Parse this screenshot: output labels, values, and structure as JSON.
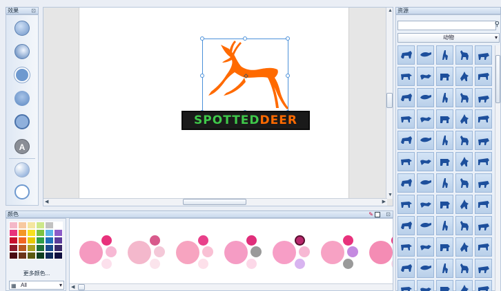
{
  "panels": {
    "effects": "效果",
    "colors": "颜色",
    "resources": "资源"
  },
  "resources": {
    "search_placeholder": "",
    "category": "动物"
  },
  "colors": {
    "more_label": "更多颜色...",
    "filter": "All",
    "swatches": [
      "#f4b8c8",
      "#f7c9a0",
      "#f4e6a0",
      "#cde88a",
      "#c2c2c2",
      "#ffffff",
      "#e8327c",
      "#f39826",
      "#f7e020",
      "#7cc242",
      "#5ab4e8",
      "#8c5cc8",
      "#c8102e",
      "#f26722",
      "#e8c800",
      "#2e9e48",
      "#1e6fb8",
      "#5a3c9a",
      "#8c1a2a",
      "#b85a20",
      "#a8a020",
      "#1e6e3a",
      "#1a4a8c",
      "#3a2a6a",
      "#4a0a10",
      "#6a3418",
      "#5a5a10",
      "#0e3e20",
      "#0e2a5a",
      "#101040"
    ]
  },
  "logo": {
    "word1": "SPOTTED",
    "word2": "DEER"
  },
  "accent": "#4a90d9",
  "palettes": [
    {
      "main": "#f59ac0",
      "a": "#e8327c",
      "b": "#f7b8d4",
      "c": "#fce0ec"
    },
    {
      "main": "#f4b8cc",
      "a": "#d85a8c",
      "b": "#f4c8d8",
      "c": "#fbe4ec"
    },
    {
      "main": "#f7a4c0",
      "a": "#e8408a",
      "b": "#f9c0d4",
      "c": "#fde0ea"
    },
    {
      "main": "#f59cc4",
      "a": "#e02e7a",
      "b": "#9a9a9a",
      "c": "#fcd8e8"
    },
    {
      "main": "#f79ec6",
      "a": "#b8286c",
      "b": "#f7b8d4",
      "c": "#d8b4f0"
    },
    {
      "main": "#f7a2c4",
      "a": "#e8327c",
      "b": "#c48ae0",
      "c": "#9a9a9a"
    },
    {
      "main": "#f48cb4",
      "a": "#e8327c",
      "b": "#f7b8d4",
      "c": "#fcd8e8"
    }
  ]
}
